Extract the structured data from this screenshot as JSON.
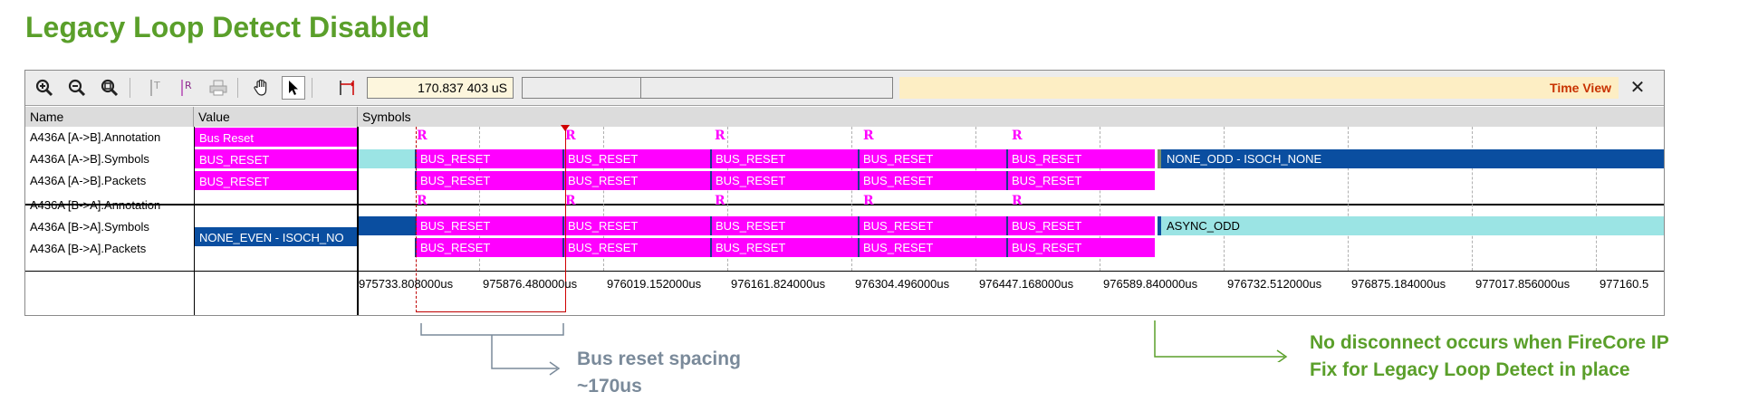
{
  "slide": {
    "title": "Legacy Loop Detect Disabled"
  },
  "toolbar": {
    "icons": [
      "zoom-in-icon",
      "zoom-out-icon",
      "zoom-fit-icon",
      "cursor-t-icon",
      "cursor-r-icon",
      "printer-icon",
      "hand-icon",
      "pointer-icon",
      "range-icon"
    ],
    "time_value": "170.837 403 uS",
    "time_view_label": "Time View",
    "close_label": "✕"
  },
  "table": {
    "headers": {
      "name": "Name",
      "value": "Value",
      "symbols": "Symbols"
    },
    "rows": [
      {
        "name": "A436A [A->B].Annotation",
        "value": "Bus Reset"
      },
      {
        "name": "A436A [A->B].Symbols",
        "value": "BUS_RESET"
      },
      {
        "name": "A436A [A->B].Packets",
        "value": "BUS_RESET"
      },
      {
        "name": "A436A [B->A].Annotation",
        "value": ""
      },
      {
        "name": "A436A [B->A].Symbols",
        "value": "NONE_EVEN - ISOCH_NO"
      },
      {
        "name": "A436A [B->A].Packets",
        "value": ""
      }
    ],
    "marker_letter": "R",
    "reset_label": "BUS_RESET",
    "after_ab": "NONE_ODD - ISOCH_NONE",
    "after_ba": "ASYNC_ODD",
    "time_ticks": [
      "975733.808000us",
      "975876.480000us",
      "976019.152000us",
      "976161.824000us",
      "976304.496000us",
      "976447.168000us",
      "976589.840000us",
      "976732.512000us",
      "976875.184000us",
      "977017.856000us",
      "977160.5"
    ]
  },
  "annotations": {
    "spacing_line1": "Bus reset spacing",
    "spacing_line2": "~170us",
    "fix_line1": "No disconnect occurs when FireCore IP",
    "fix_line2": "Fix for Legacy Loop Detect in place"
  },
  "colors": {
    "title_green": "#5a9f2a",
    "magenta": "#ff00ff",
    "blue": "#0a4ea0",
    "cyan": "#9be4e4",
    "annotation_gray": "#7a8a9a"
  }
}
